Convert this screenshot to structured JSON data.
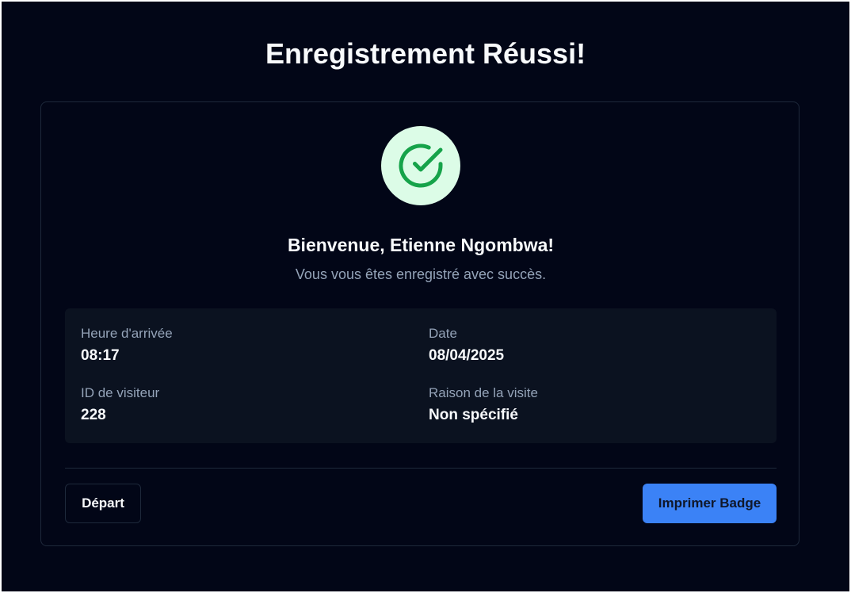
{
  "page": {
    "title": "Enregistrement Réussi!"
  },
  "card": {
    "welcome": "Bienvenue, Etienne Ngombwa!",
    "subtext": "Vous vous êtes enregistré avec succès.",
    "status_icon": "check-circle-icon",
    "colors": {
      "icon_background": "#dcfce7",
      "icon_stroke": "#16a34a",
      "primary_button": "#3b82f6",
      "page_background": "#020617"
    }
  },
  "details": {
    "arrival_time": {
      "label": "Heure d'arrivée",
      "value": "08:17"
    },
    "date": {
      "label": "Date",
      "value": "08/04/2025"
    },
    "visitor_id": {
      "label": "ID de visiteur",
      "value": "228"
    },
    "visit_reason": {
      "label": "Raison de la visite",
      "value": "Non spécifié"
    }
  },
  "actions": {
    "depart_label": "Départ",
    "print_label": "Imprimer Badge"
  }
}
